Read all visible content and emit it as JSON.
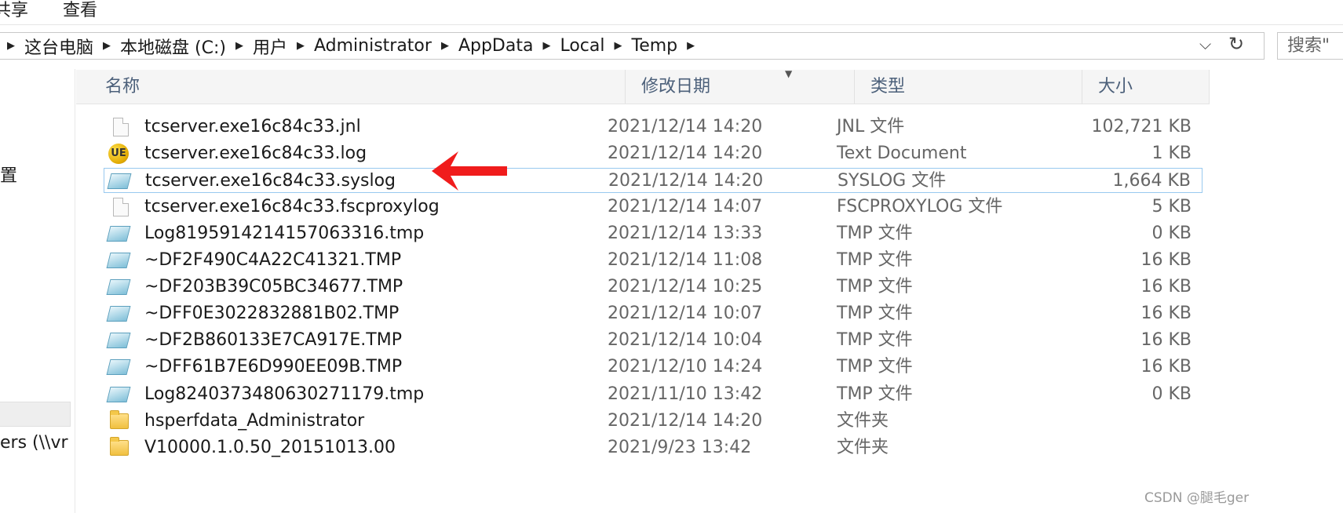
{
  "ribbon": {
    "share": "共享",
    "view": "查看"
  },
  "address_bar": {
    "crumbs": [
      "这台电脑",
      "本地磁盘 (C:)",
      "用户",
      "Administrator",
      "AppData",
      "Local",
      "Temp"
    ],
    "dropdown_icon": "chevron-down-icon",
    "refresh_icon": "refresh-icon"
  },
  "search": {
    "placeholder": "搜索\""
  },
  "nav_pane": {
    "item1": "置",
    "item2": "ers (\\\\vr"
  },
  "columns": {
    "name": "名称",
    "date": "修改日期",
    "type": "类型",
    "size": "大小"
  },
  "files": [
    {
      "name": "tcserver.exe16c84c33.jnl",
      "date": "2021/12/14 14:20",
      "type": "JNL 文件",
      "size": "102,721 KB",
      "icon": "document-icon"
    },
    {
      "name": "tcserver.exe16c84c33.log",
      "date": "2021/12/14 14:20",
      "type": "Text Document",
      "size": "1 KB",
      "icon": "ultraedit-icon"
    },
    {
      "name": "tcserver.exe16c84c33.syslog",
      "date": "2021/12/14 14:20",
      "type": "SYSLOG 文件",
      "size": "1,664 KB",
      "icon": "tmp-file-icon",
      "selected": true
    },
    {
      "name": "tcserver.exe16c84c33.fscproxylog",
      "date": "2021/12/14 14:07",
      "type": "FSCPROXYLOG 文件",
      "size": "5 KB",
      "icon": "document-icon"
    },
    {
      "name": "Log8195914214157063316.tmp",
      "date": "2021/12/14 13:33",
      "type": "TMP 文件",
      "size": "0 KB",
      "icon": "tmp-file-icon"
    },
    {
      "name": "~DF2F490C4A22C41321.TMP",
      "date": "2021/12/14 11:08",
      "type": "TMP 文件",
      "size": "16 KB",
      "icon": "tmp-file-icon"
    },
    {
      "name": "~DF203B39C05BC34677.TMP",
      "date": "2021/12/14 10:25",
      "type": "TMP 文件",
      "size": "16 KB",
      "icon": "tmp-file-icon"
    },
    {
      "name": "~DFF0E3022832881B02.TMP",
      "date": "2021/12/14 10:07",
      "type": "TMP 文件",
      "size": "16 KB",
      "icon": "tmp-file-icon"
    },
    {
      "name": "~DF2B860133E7CA917E.TMP",
      "date": "2021/12/14 10:04",
      "type": "TMP 文件",
      "size": "16 KB",
      "icon": "tmp-file-icon"
    },
    {
      "name": "~DFF61B7E6D990EE09B.TMP",
      "date": "2021/12/10 14:24",
      "type": "TMP 文件",
      "size": "16 KB",
      "icon": "tmp-file-icon"
    },
    {
      "name": "Log8240373480630271179.tmp",
      "date": "2021/11/10 13:42",
      "type": "TMP 文件",
      "size": "0 KB",
      "icon": "tmp-file-icon"
    },
    {
      "name": "hsperfdata_Administrator",
      "date": "2021/12/14 14:20",
      "type": "文件夹",
      "size": "",
      "icon": "folder-icon"
    },
    {
      "name": "V10000.1.0.50_20151013.00",
      "date": "2021/9/23 13:42",
      "type": "文件夹",
      "size": "",
      "icon": "folder-icon"
    }
  ],
  "colors": {
    "header_text": "#4c607a",
    "selection_border": "#99c9ef",
    "arrow": "#f01c1c"
  },
  "watermark": "CSDN @腿毛ger"
}
